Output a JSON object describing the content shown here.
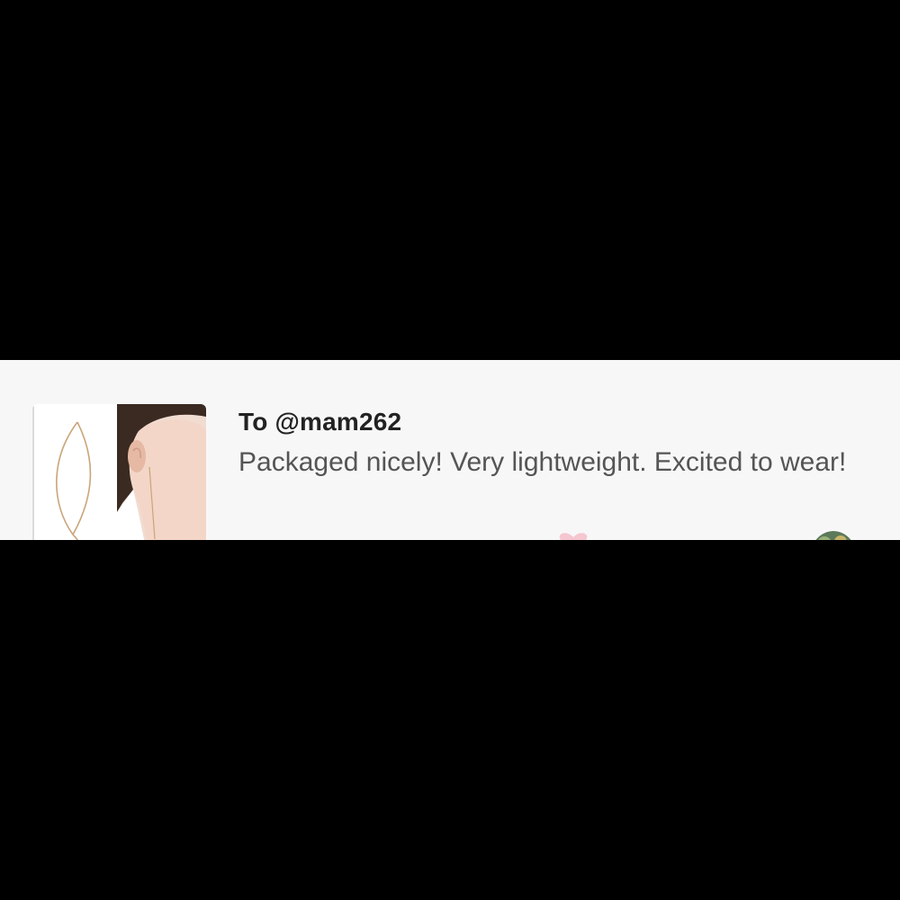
{
  "review": {
    "recipient": "To @mam262",
    "text": "Packaged nicely! Very lightweight. Excited to wear!"
  },
  "product": {
    "image_icon": "earring-product-photo"
  },
  "footer": {
    "text": ""
  },
  "colors": {
    "background": "#f8f7f8",
    "heart": "#f5c6cf",
    "text_primary": "#222222",
    "text_secondary": "#555555"
  }
}
